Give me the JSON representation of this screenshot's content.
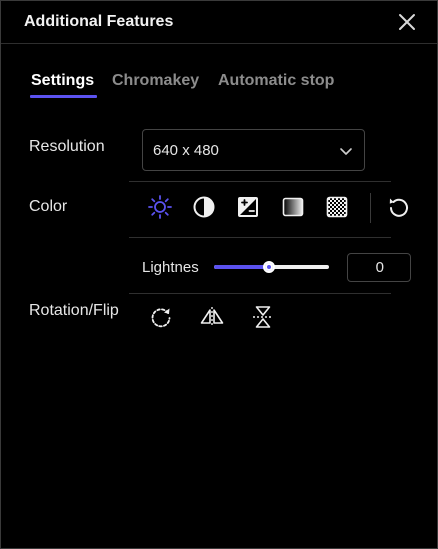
{
  "window": {
    "title": "Additional Features"
  },
  "tabs": [
    {
      "label": "Settings",
      "active": true
    },
    {
      "label": "Chromakey",
      "active": false
    },
    {
      "label": "Automatic stop",
      "active": false
    }
  ],
  "resolution": {
    "label": "Resolution",
    "selected": "640 x 480"
  },
  "color": {
    "label": "Color",
    "tools": [
      "brightness-icon",
      "contrast-icon",
      "exposure-icon",
      "gradient-icon",
      "checker-icon"
    ],
    "reset_icon": "reset-icon",
    "active_tool": "brightness-icon"
  },
  "slider": {
    "label": "Lightnes",
    "value": "0",
    "level_fraction": 0.48
  },
  "rotation": {
    "label": "Rotation/Flip",
    "tools": [
      "rotate-icon",
      "flip-horizontal-icon",
      "flip-vertical-icon"
    ]
  },
  "colors": {
    "accent": "#5b52f0",
    "background": "#000000",
    "text": "#e6e6e6",
    "muted": "#8c8c8c"
  }
}
